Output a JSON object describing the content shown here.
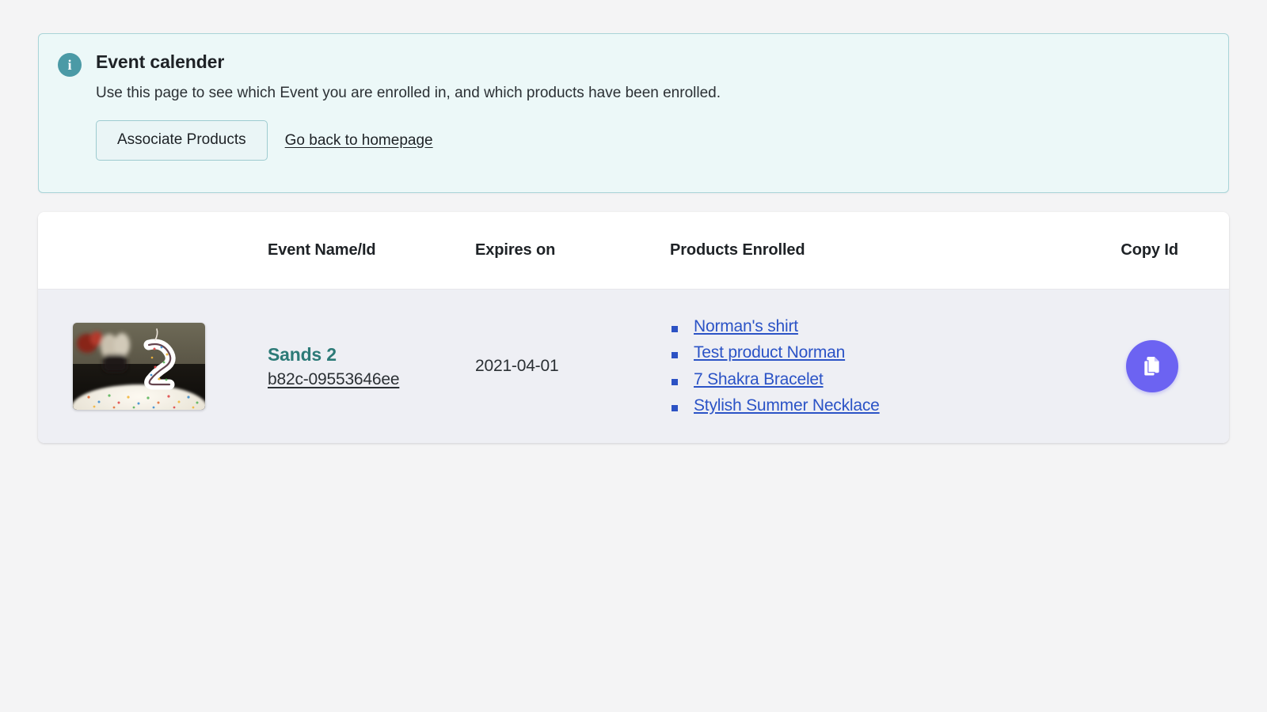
{
  "page": {
    "background_color": "#f4f4f5"
  },
  "banner": {
    "icon": "info-icon",
    "icon_glyph": "i",
    "title": "Event calender",
    "description": "Use this page to see which Event you are enrolled in, and which products have been enrolled.",
    "primary_button_label": "Associate Products",
    "secondary_link_label": "Go back to homepage",
    "background_color": "#ecf8f8",
    "border_color": "#a9d4d8",
    "icon_color": "#4b9aa6"
  },
  "table": {
    "columns": [
      {
        "key": "thumb",
        "label": ""
      },
      {
        "key": "name",
        "label": "Event Name/Id"
      },
      {
        "key": "date",
        "label": "Expires on"
      },
      {
        "key": "products",
        "label": "Products Enrolled"
      },
      {
        "key": "copy",
        "label": "Copy Id"
      }
    ],
    "rows": [
      {
        "thumbnail_alt": "birthday cake with number 2 candle",
        "event_name": "Sands 2",
        "event_id": "b82c-09553646ee",
        "expires_on": "2021-04-01",
        "products": [
          "Norman's shirt",
          "Test product Norman",
          "7 Shakra Bracelet",
          "Stylish Summer Necklace"
        ],
        "copy_button_icon": "copy-icon"
      }
    ],
    "header_background": "#ffffff",
    "row_background": "#eeeff4",
    "event_name_color": "#2c7a77",
    "product_link_color": "#2b53c6",
    "copy_button_color": "#6c63f2"
  }
}
